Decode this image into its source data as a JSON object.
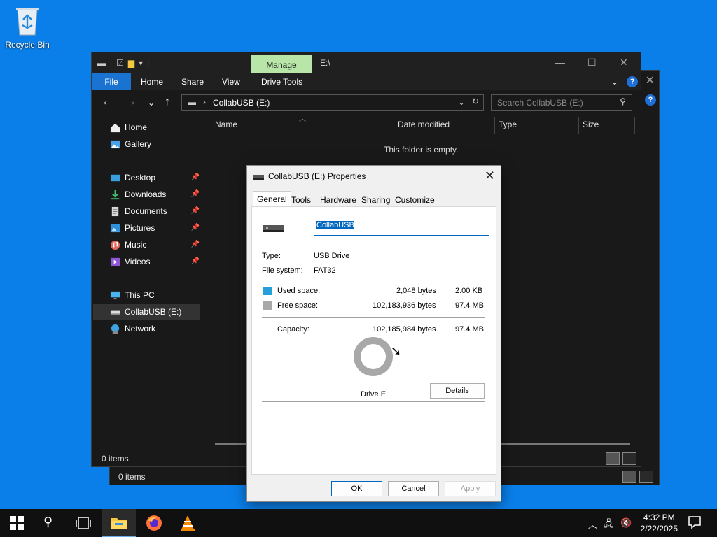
{
  "desktop": {
    "recycle_bin": "Recycle Bin"
  },
  "back_window": {
    "status": "0 items"
  },
  "explorer": {
    "manage_tab": "Manage",
    "title_path": "E:\\",
    "ribbon_tabs": [
      "File",
      "Home",
      "Share",
      "View",
      "Drive Tools"
    ],
    "address": "CollabUSB (E:)",
    "search_placeholder": "Search CollabUSB (E:)",
    "sidebar": [
      {
        "label": "Home",
        "icon": "home-icon",
        "pinned": false
      },
      {
        "label": "Gallery",
        "icon": "gallery-icon",
        "pinned": false
      },
      {
        "label": "Desktop",
        "icon": "desktop-folder-icon",
        "pinned": true
      },
      {
        "label": "Downloads",
        "icon": "download-icon",
        "pinned": true
      },
      {
        "label": "Documents",
        "icon": "documents-icon",
        "pinned": true
      },
      {
        "label": "Pictures",
        "icon": "pictures-icon",
        "pinned": true
      },
      {
        "label": "Music",
        "icon": "music-icon",
        "pinned": true
      },
      {
        "label": "Videos",
        "icon": "videos-icon",
        "pinned": true
      },
      {
        "label": "This PC",
        "icon": "pc-icon",
        "pinned": false
      },
      {
        "label": "CollabUSB (E:)",
        "icon": "usb-drive-icon",
        "pinned": false,
        "selected": true
      },
      {
        "label": "Network",
        "icon": "network-icon",
        "pinned": false
      }
    ],
    "columns": [
      "Name",
      "Date modified",
      "Type",
      "Size"
    ],
    "empty_message": "This folder is empty.",
    "status": "0 items"
  },
  "dialog": {
    "title": "CollabUSB (E:) Properties",
    "tabs": [
      "General",
      "Tools",
      "Hardware",
      "Sharing",
      "Customize"
    ],
    "active_tab": "General",
    "name_value": "CollabUSB",
    "type_label": "Type:",
    "type_value": "USB Drive",
    "fs_label": "File system:",
    "fs_value": "FAT32",
    "used_label": "Used space:",
    "used_bytes": "2,048 bytes",
    "used_human": "2.00 KB",
    "free_label": "Free space:",
    "free_bytes": "102,183,936 bytes",
    "free_human": "97.4 MB",
    "capacity_label": "Capacity:",
    "capacity_bytes": "102,185,984 bytes",
    "capacity_human": "97.4 MB",
    "drive_label": "Drive E:",
    "details_button": "Details",
    "ok_button": "OK",
    "cancel_button": "Cancel",
    "apply_button": "Apply",
    "colors": {
      "used": "#26a0da",
      "free": "#a8a8a8"
    }
  },
  "taskbar": {
    "time": "4:32 PM",
    "date": "2/22/2025"
  }
}
